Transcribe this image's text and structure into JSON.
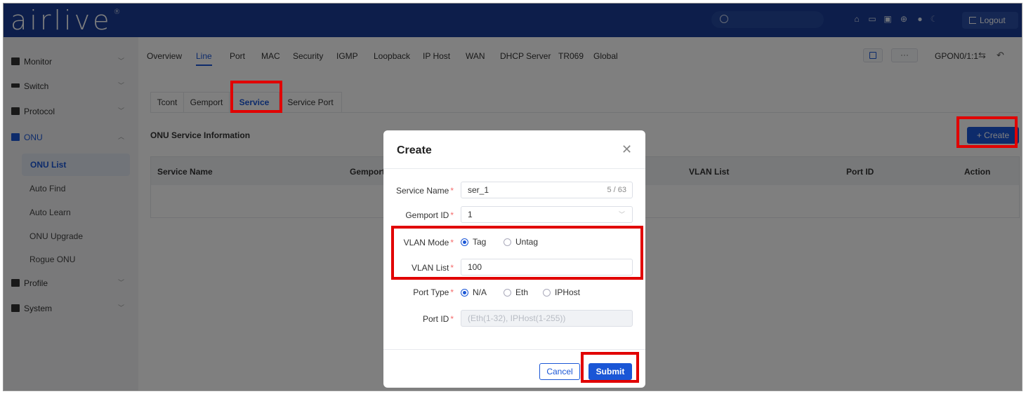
{
  "header": {
    "logo": "airlive",
    "logo_mark": "®",
    "logout_label": "Logout",
    "icons": [
      "home-icon",
      "monitor-icon",
      "save-icon",
      "globe-icon",
      "theme-icon",
      "moon-icon"
    ]
  },
  "sidebar": {
    "items": [
      {
        "label": "Monitor",
        "icon": "monitor-icon"
      },
      {
        "label": "Switch",
        "icon": "switch-icon"
      },
      {
        "label": "Protocol",
        "icon": "protocol-icon"
      },
      {
        "label": "ONU",
        "icon": "onu-icon"
      },
      {
        "label": "Profile",
        "icon": "profile-icon"
      },
      {
        "label": "System",
        "icon": "system-icon"
      }
    ],
    "onu_sub": [
      "ONU List",
      "Auto Find",
      "Auto Learn",
      "ONU Upgrade",
      "Rogue ONU"
    ]
  },
  "main": {
    "tabs": [
      "Overview",
      "Line",
      "Port",
      "MAC",
      "Security",
      "IGMP",
      "Loopback",
      "IP Host",
      "WAN",
      "DHCP Server",
      "TR069",
      "Global"
    ],
    "active_tab": "Line",
    "more_label": "···",
    "port_label": "GPON0/1:1",
    "sub_tabs": [
      "Tcont",
      "Gemport",
      "Service",
      "Service Port"
    ],
    "active_sub_tab": "Service",
    "section_title": "ONU Service Information",
    "create_label": "+ Create",
    "table_headers": [
      "Service Name",
      "Gemport ID",
      "VLAN List",
      "Port ID",
      "Action"
    ]
  },
  "modal": {
    "title": "Create",
    "fields": {
      "service_name": {
        "label": "Service Name",
        "value": "ser_1",
        "count": "5 / 63"
      },
      "gemport_id": {
        "label": "Gemport ID",
        "value": "1"
      },
      "vlan_mode": {
        "label": "VLAN Mode",
        "options": [
          "Tag",
          "Untag"
        ],
        "selected": "Tag"
      },
      "vlan_list": {
        "label": "VLAN List",
        "value": "100"
      },
      "port_type": {
        "label": "Port Type",
        "options": [
          "N/A",
          "Eth",
          "IPHost"
        ],
        "selected": "N/A"
      },
      "port_id": {
        "label": "Port ID",
        "placeholder": "(Eth(1-32), IPHost(1-255))"
      }
    },
    "required_mark": "*",
    "cancel_label": "Cancel",
    "submit_label": "Submit"
  }
}
